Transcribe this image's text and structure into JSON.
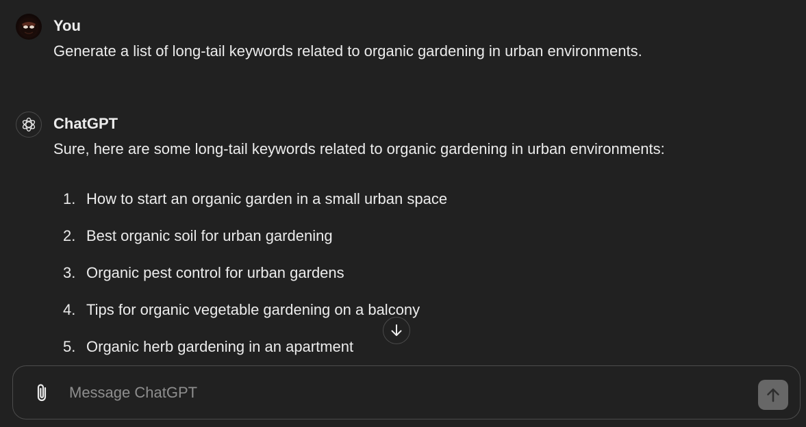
{
  "conversation": {
    "user_message": {
      "author": "You",
      "text": "Generate a list of long-tail keywords related to organic gardening in urban environments."
    },
    "assistant_message": {
      "author": "ChatGPT",
      "intro": "Sure, here are some long-tail keywords related to organic gardening in urban environments:",
      "items": [
        {
          "num": "1.",
          "text": "How to start an organic garden in a small urban space"
        },
        {
          "num": "2.",
          "text": "Best organic soil for urban gardening"
        },
        {
          "num": "3.",
          "text": "Organic pest control for urban gardens"
        },
        {
          "num": "4.",
          "text": "Tips for organic vegetable gardening on a balcony"
        },
        {
          "num": "5.",
          "text": "Organic herb gardening in an apartment"
        }
      ]
    }
  },
  "composer": {
    "placeholder": "Message ChatGPT",
    "value": ""
  },
  "icons": {
    "attach": "paperclip-icon",
    "send": "arrow-up-icon",
    "scroll": "arrow-down-icon",
    "assistant_logo": "openai-logo-icon"
  },
  "colors": {
    "background": "#212121",
    "text": "#ececec",
    "placeholder": "#8e8e8e",
    "border": "#4d4d4d",
    "send_button_disabled": "#676767"
  }
}
